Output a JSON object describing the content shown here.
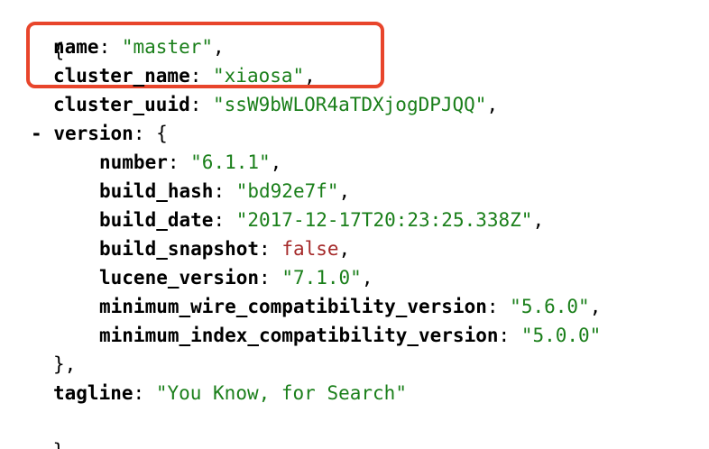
{
  "json_view": {
    "open_brace": "{",
    "close_brace": "}",
    "name": {
      "key": "name",
      "value": "\"master\""
    },
    "cluster_name": {
      "key": "cluster_name",
      "value": "\"xiaosa\""
    },
    "cluster_uuid": {
      "key": "cluster_uuid",
      "value": "\"ssW9bWLOR4aTDXjogDPJQQ\""
    },
    "version": {
      "toggle": "-",
      "key": "version",
      "open": "{",
      "close": "},",
      "number": {
        "key": "number",
        "value": "\"6.1.1\""
      },
      "build_hash": {
        "key": "build_hash",
        "value": "\"bd92e7f\""
      },
      "build_date": {
        "key": "build_date",
        "value": "\"2017-12-17T20:23:25.338Z\""
      },
      "build_snapshot": {
        "key": "build_snapshot",
        "value": "false"
      },
      "lucene_version": {
        "key": "lucene_version",
        "value": "\"7.1.0\""
      },
      "minimum_wire_compatibility_version": {
        "key": "minimum_wire_compatibility_version",
        "value": "\"5.6.0\""
      },
      "minimum_index_compatibility_version": {
        "key": "minimum_index_compatibility_version",
        "value": "\"5.0.0\""
      }
    },
    "tagline": {
      "key": "tagline",
      "value": "\"You Know, for Search\""
    }
  },
  "colors": {
    "key": "#000000",
    "string": "#1a7f1a",
    "boolean": "#a52a2a",
    "highlight": "#e8452b"
  }
}
